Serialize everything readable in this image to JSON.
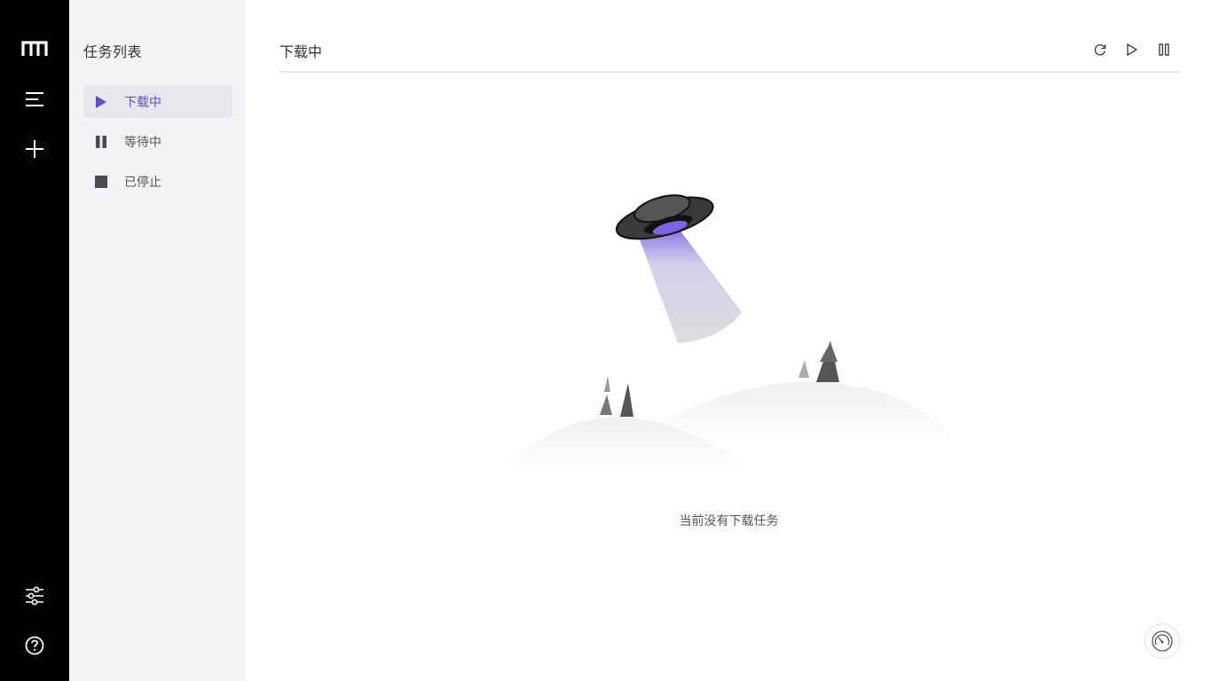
{
  "rail": {
    "logo_icon": "motrix-logo-icon",
    "items": [
      {
        "icon": "task-list-icon"
      },
      {
        "icon": "add-task-icon"
      },
      {
        "icon": "preferences-icon"
      },
      {
        "icon": "help-icon"
      }
    ]
  },
  "sidebar": {
    "title": "任务列表",
    "items": [
      {
        "label": "下载中",
        "icon": "play-icon",
        "active": true
      },
      {
        "label": "等待中",
        "icon": "pause-icon",
        "active": false
      },
      {
        "label": "已停止",
        "icon": "stop-icon",
        "active": false
      }
    ]
  },
  "main": {
    "title": "下载中",
    "toolbar": [
      {
        "icon": "refresh-icon"
      },
      {
        "icon": "resume-all-icon"
      },
      {
        "icon": "pause-all-icon"
      }
    ],
    "empty_text": "当前没有下载任务",
    "speed_icon": "speedometer-icon"
  },
  "colors": {
    "rail_bg": "#000000",
    "sidebar_bg": "#f3f4f6",
    "accent": "#5b4bd6"
  }
}
